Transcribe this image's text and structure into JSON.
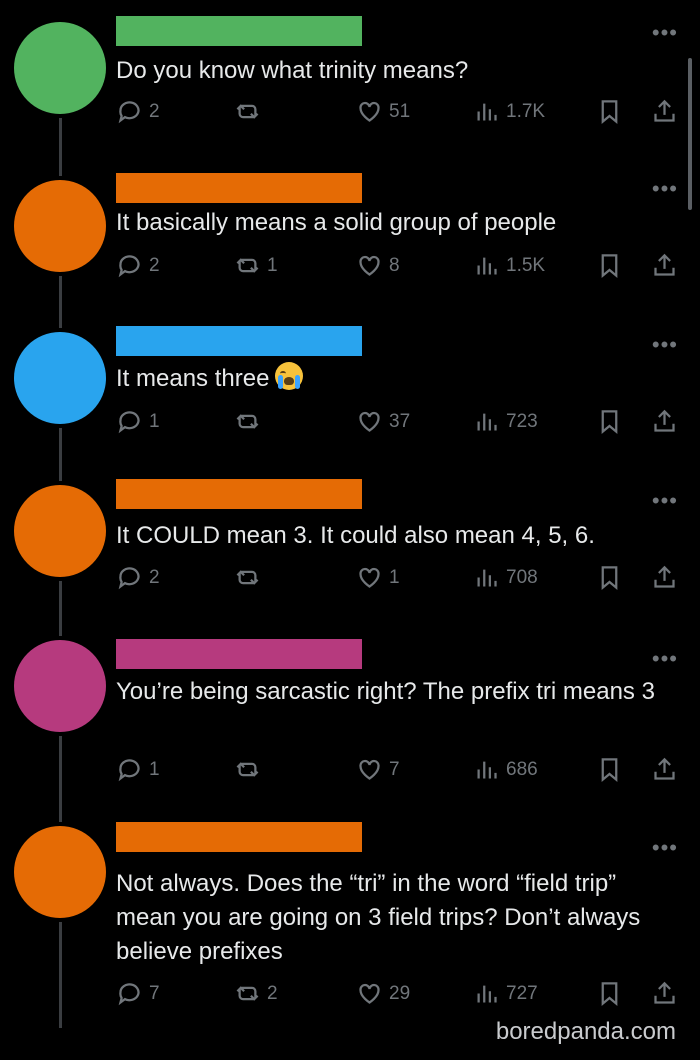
{
  "tweets": [
    {
      "color": "#52b35f",
      "bar": "#52b35f",
      "text": "Do you know what trinity means?",
      "replies": "2",
      "retweets": "",
      "likes": "51",
      "views": "1.7K",
      "emoji": false
    },
    {
      "color": "#e56b05",
      "bar": "#e56b05",
      "text": "It basically means a solid group of people",
      "replies": "2",
      "retweets": "1",
      "likes": "8",
      "views": "1.5K",
      "emoji": false
    },
    {
      "color": "#29a4ee",
      "bar": "#29a4ee",
      "text": "It means three",
      "replies": "1",
      "retweets": "",
      "likes": "37",
      "views": "723",
      "emoji": true
    },
    {
      "color": "#e56b05",
      "bar": "#e56b05",
      "text": "It COULD mean 3. It could also mean 4, 5, 6.",
      "replies": "2",
      "retweets": "",
      "likes": "1",
      "views": "708",
      "emoji": false
    },
    {
      "color": "#b63a7e",
      "bar": "#b63a7e",
      "text": "You’re being sarcastic right? The prefix tri means 3",
      "replies": "1",
      "retweets": "",
      "likes": "7",
      "views": "686",
      "emoji": false
    },
    {
      "color": "#e56b05",
      "bar": "#e56b05",
      "text": "Not always. Does the “tri” in the word “field trip” mean you are going on 3 field trips? Don’t always believe prefixes",
      "replies": "7",
      "retweets": "2",
      "likes": "29",
      "views": "727",
      "emoji": false
    }
  ],
  "more_label": "•••",
  "watermark": "boredpanda.com",
  "icons": [
    "reply-icon",
    "retweet-icon",
    "like-icon",
    "views-icon",
    "bookmark-icon",
    "share-icon"
  ]
}
